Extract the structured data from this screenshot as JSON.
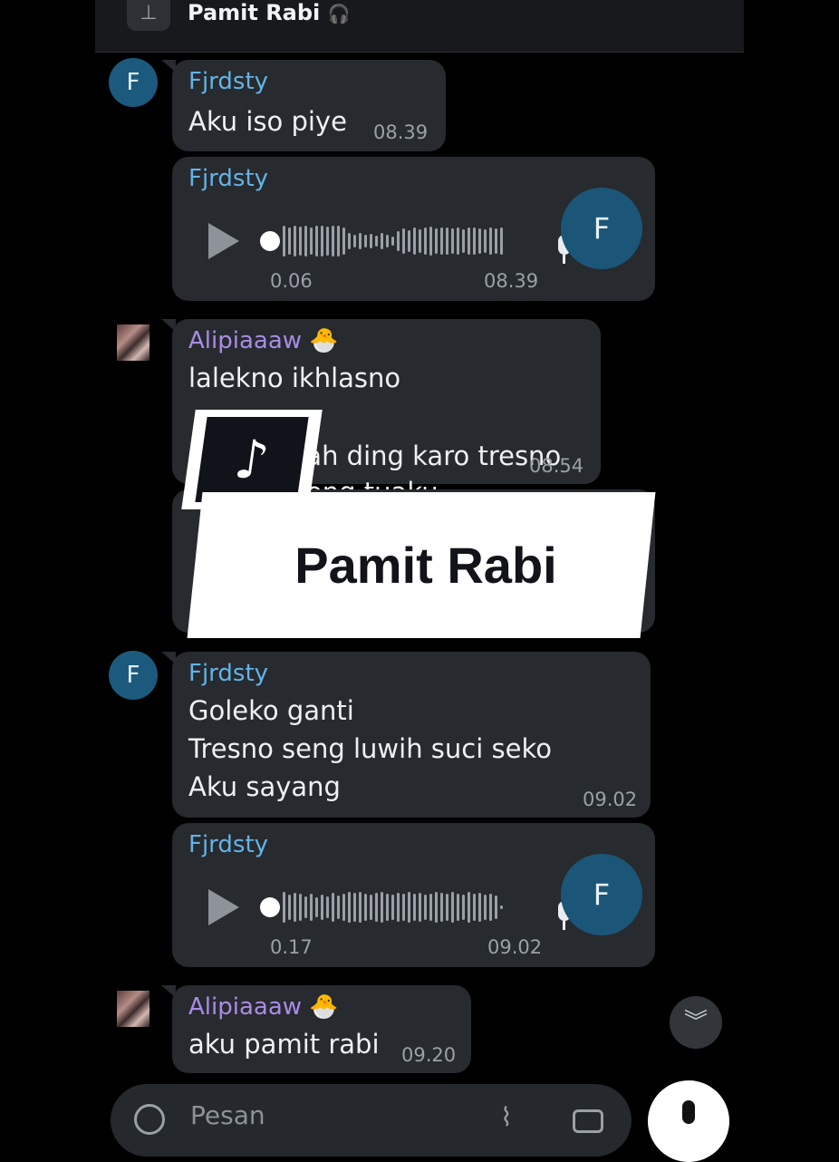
{
  "header": {
    "pinned_title": "Pamit Rabi",
    "pin_icon": "pin-icon",
    "headphones_icon": "headphones-icon"
  },
  "messages": [
    {
      "sender": "Fjrdsty",
      "text": "Aku iso piye",
      "time": "08.39",
      "avatar_letter": "F"
    },
    {
      "sender": "Fjrdsty",
      "voice_duration": "0.06",
      "time": "08.39",
      "avatar_letter": "F"
    },
    {
      "sender": "Alipiaaaw 🐣",
      "lines": [
        "lalekno ikhlasno",
        "aku dipisah ding karo tresno liyo",
        "pilihan wong tuaku"
      ],
      "visible_fragments": [
        "lalekno ikhlasno",
        "ding karo tresno liyo",
        "wong tuaku"
      ],
      "time": "08.54"
    },
    {
      "sender": "Fjrdsty",
      "text": "Goleko ganti\nTresno seng luwih suci seko\nAku sayang",
      "time": "09.02",
      "avatar_letter": "F"
    },
    {
      "sender": "Fjrdsty",
      "voice_duration": "0.17",
      "time": "09.02",
      "avatar_letter": "F"
    },
    {
      "sender": "Alipiaaaw 🐣",
      "text": "aku pamit rabi",
      "time": "09.20"
    }
  ],
  "overlay": {
    "banner_text": "Pamit Rabi",
    "logo": "tiktok-logo"
  },
  "compose": {
    "placeholder": "Pesan",
    "emoji_icon": "emoji-icon",
    "attach_icon": "paperclip-icon",
    "camera_icon": "camera-icon",
    "mic_icon": "mic-icon"
  },
  "scroll_down_icon": "double-chevron-down-icon"
}
